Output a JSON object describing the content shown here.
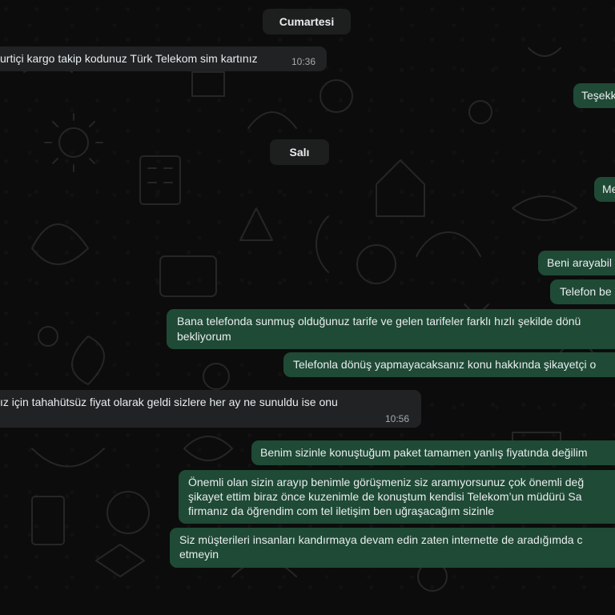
{
  "chat": {
    "date_separators": {
      "saturday": "Cumartesi",
      "tuesday": "Salı"
    },
    "messages": [
      {
        "direction": "incoming",
        "text": "urtiçi kargo takip kodunuz Türk Telekom sim kartınız",
        "time": "10:36"
      },
      {
        "direction": "outgoing",
        "text": "Teşekk"
      },
      {
        "direction": "outgoing",
        "text": "Me"
      },
      {
        "direction": "outgoing",
        "text": "Beni arayabil"
      },
      {
        "direction": "outgoing",
        "text": "Telefon be"
      },
      {
        "direction": "outgoing",
        "lines": [
          "Bana telefonda sunmuş olduğunuz tarife ve gelen tarifeler farklı hızlı şekilde dönü",
          "bekliyorum"
        ]
      },
      {
        "direction": "outgoing",
        "text": "Telefonla dönüş yapmayacaksanız konu hakkında şikayetçi o"
      },
      {
        "direction": "incoming",
        "text": "ız için tahahütsüz fiyat olarak geldi sizlere her ay ne sunuldu ise onu",
        "time": "10:56"
      },
      {
        "direction": "outgoing",
        "text": "Benim sizinle konuştuğum paket tamamen yanlış fiyatında değilim"
      },
      {
        "direction": "outgoing",
        "lines": [
          "Önemli olan sizin arayıp benimle görüşmeniz siz aramıyorsunuz çok önemli değ",
          "şikayet ettim biraz önce kuzenimle de konuştum kendisi Telekom’un müdürü Sa",
          "firmanız da öğrendim com tel iletişim ben uğraşacağım sizinle"
        ]
      },
      {
        "direction": "outgoing",
        "lines": [
          "Siz müşterileri insanları kandırmaya devam edin zaten internette de aradığımda c",
          "etmeyin"
        ]
      }
    ]
  }
}
